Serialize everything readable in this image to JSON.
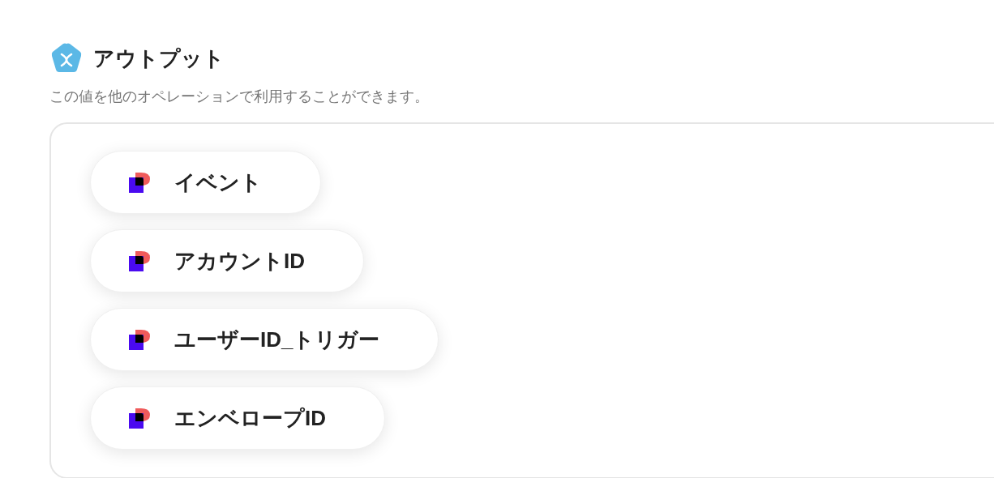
{
  "section": {
    "title": "アウトプット",
    "description": "この値を他のオペレーションで利用することができます。"
  },
  "outputs": [
    {
      "label": "イベント"
    },
    {
      "label": "アカウントID"
    },
    {
      "label": "ユーザーID_トリガー"
    },
    {
      "label": "エンベロープID"
    }
  ]
}
